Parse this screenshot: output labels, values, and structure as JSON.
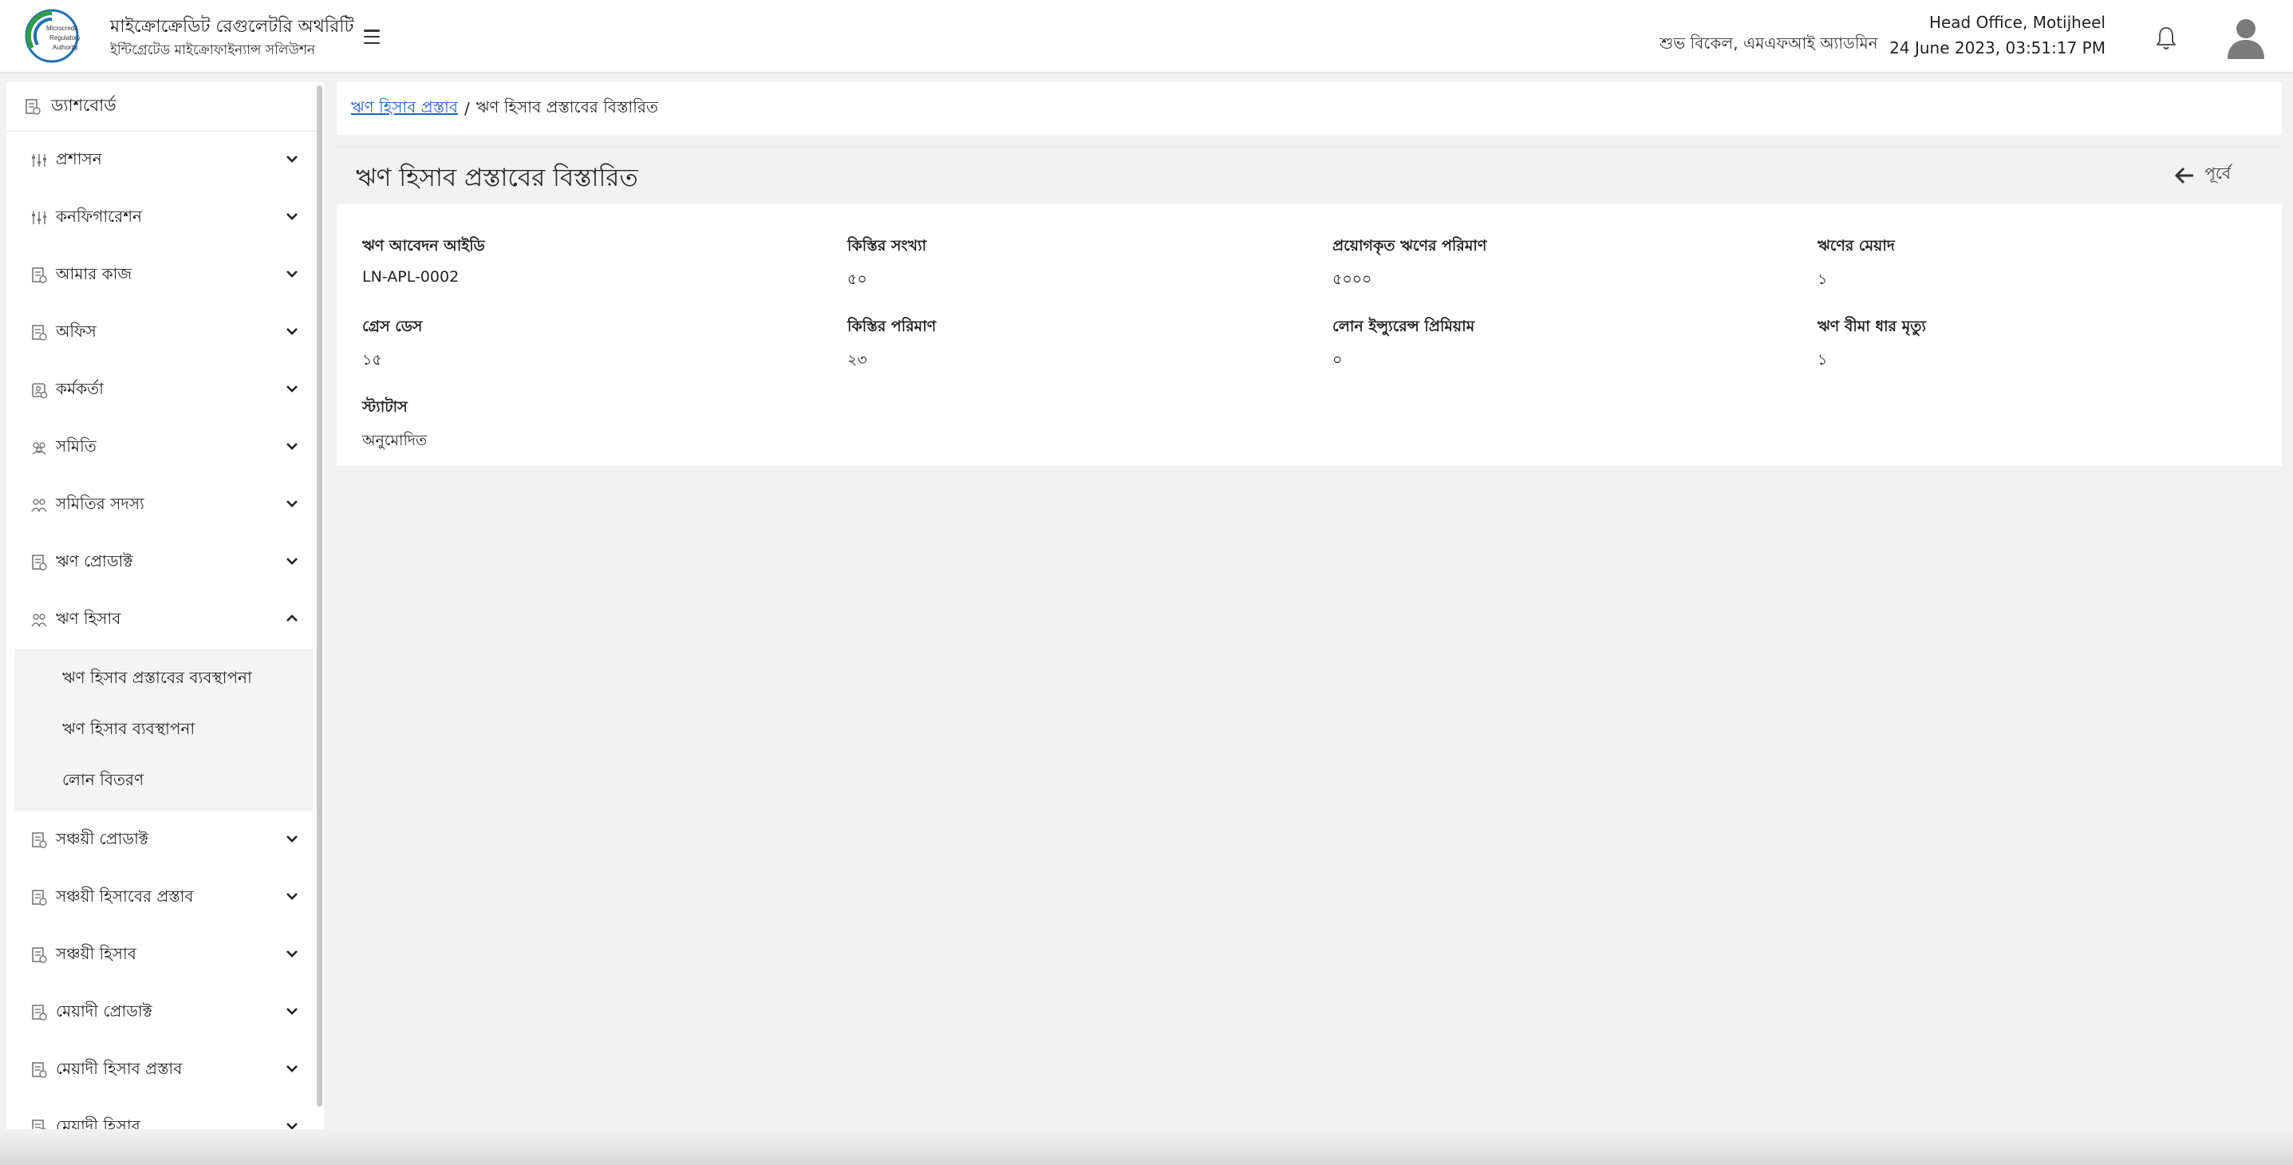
{
  "header": {
    "logo_text": [
      "Microcredit",
      "Regulatory",
      "Authority"
    ],
    "brand_title": "মাইক্রোক্রেডিট রেগুলেটরি অথরিটি",
    "brand_subtitle": "ইন্টিগ্রেটেড মাইক্রোফাইন্যান্স সলিউশন",
    "greeting": "শুভ বিকেল, এমএফআই অ্যাডমিন",
    "office": "Head Office, Motijheel",
    "datetime": "24 June 2023, 03:51:17 PM"
  },
  "sidebar": {
    "dashboard": "ড্যাশবোর্ড",
    "items": [
      {
        "label": "প্রশাসন",
        "icon": "sliders-icon"
      },
      {
        "label": "কনফিগারেশন",
        "icon": "sliders-icon"
      },
      {
        "label": "আমার কাজ",
        "icon": "document-icon"
      },
      {
        "label": "অফিস",
        "icon": "document-icon"
      },
      {
        "label": "কর্মকর্তা",
        "icon": "id-card-icon"
      },
      {
        "label": "সমিতি",
        "icon": "group-icon"
      },
      {
        "label": "সমিতির সদস্য",
        "icon": "users-icon"
      },
      {
        "label": "ঋণ প্রোডাক্ট",
        "icon": "document-icon"
      },
      {
        "label": "ঋণ হিসাব",
        "icon": "users-icon"
      },
      {
        "label": "সঞ্চয়ী প্রোডাক্ট",
        "icon": "document-icon"
      },
      {
        "label": "সঞ্চয়ী হিসাবের প্রস্তাব",
        "icon": "document-icon"
      },
      {
        "label": "সঞ্চয়ী হিসাব",
        "icon": "document-icon"
      },
      {
        "label": "মেয়াদী প্রোডাক্ট",
        "icon": "document-icon"
      },
      {
        "label": "মেয়াদী হিসাব প্রস্তাব",
        "icon": "document-icon"
      },
      {
        "label": "মেয়াদী হিসাব",
        "icon": "document-icon"
      }
    ],
    "submenu": [
      "ঋণ হিসাব প্রস্তাবের ব্যবস্থাপনা",
      "ঋণ হিসাব ব্যবস্থাপনা",
      "লোন বিতরণ"
    ]
  },
  "breadcrumb": {
    "link": "ঋণ হিসাব প্রস্তাব",
    "separator": "/",
    "current": "ঋণ হিসাব প্রস্তাবের বিস্তারিত"
  },
  "page": {
    "title": "ঋণ হিসাব প্রস্তাবের বিস্তারিত",
    "back_label": "পূর্বে"
  },
  "fields": [
    {
      "label": "ঋণ আবেদন আইডি",
      "value": "LN-APL-0002"
    },
    {
      "label": "কিস্তির সংখ্যা",
      "value": "৫০"
    },
    {
      "label": "প্রয়োগকৃত ঋণের পরিমাণ",
      "value": "৫০০০"
    },
    {
      "label": "ঋণের মেয়াদ",
      "value": "১"
    },
    {
      "label": "গ্রেস ডেস",
      "value": "১৫"
    },
    {
      "label": "কিস্তির পরিমাণ",
      "value": "২৩"
    },
    {
      "label": "লোন ইন্স্যুরেন্স প্রিমিয়াম",
      "value": "০"
    },
    {
      "label": "ঋণ বীমা ধার মৃত্যু",
      "value": "১"
    },
    {
      "label": "স্ট্যাটাস",
      "value": "অনুমোদিত"
    }
  ],
  "colors": {
    "link": "#1a5fd0",
    "logo_green": "#2e9e4a",
    "logo_blue": "#1e6fb8"
  }
}
